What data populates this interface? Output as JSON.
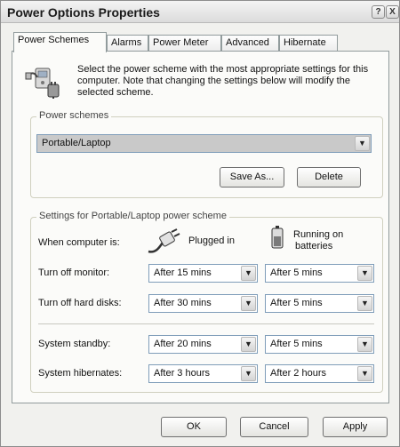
{
  "window": {
    "title": "Power Options Properties"
  },
  "titlebar": {
    "help": "?",
    "close": "X"
  },
  "tabs": [
    "Power Schemes",
    "Alarms",
    "Power Meter",
    "Advanced",
    "Hibernate"
  ],
  "intro": "Select the power scheme with the most appropriate settings for this computer. Note that changing the settings below will modify the selected scheme.",
  "schemes": {
    "group_label": "Power schemes",
    "selected": "Portable/Laptop",
    "save_as": "Save As...",
    "delete": "Delete"
  },
  "settings": {
    "group_label": "Settings for Portable/Laptop power scheme",
    "when_label": "When computer is:",
    "plugged_in": "Plugged in",
    "running_on": "Running on",
    "batteries": "batteries",
    "rows": [
      {
        "label": "Turn off monitor:",
        "plugged": "After 15 mins",
        "battery": "After 5 mins"
      },
      {
        "label": "Turn off hard disks:",
        "plugged": "After 30 mins",
        "battery": "After 5 mins"
      },
      {
        "label": "System standby:",
        "plugged": "After 20 mins",
        "battery": "After 5 mins"
      },
      {
        "label": "System hibernates:",
        "plugged": "After 3 hours",
        "battery": "After 2 hours"
      }
    ]
  },
  "buttons": {
    "ok": "OK",
    "cancel": "Cancel",
    "apply": "Apply"
  },
  "icons": {
    "power-scheme": "power-plug-computer-icon",
    "plug": "plug-icon",
    "battery": "battery-icon",
    "dropdown": "chevron-down-icon"
  }
}
